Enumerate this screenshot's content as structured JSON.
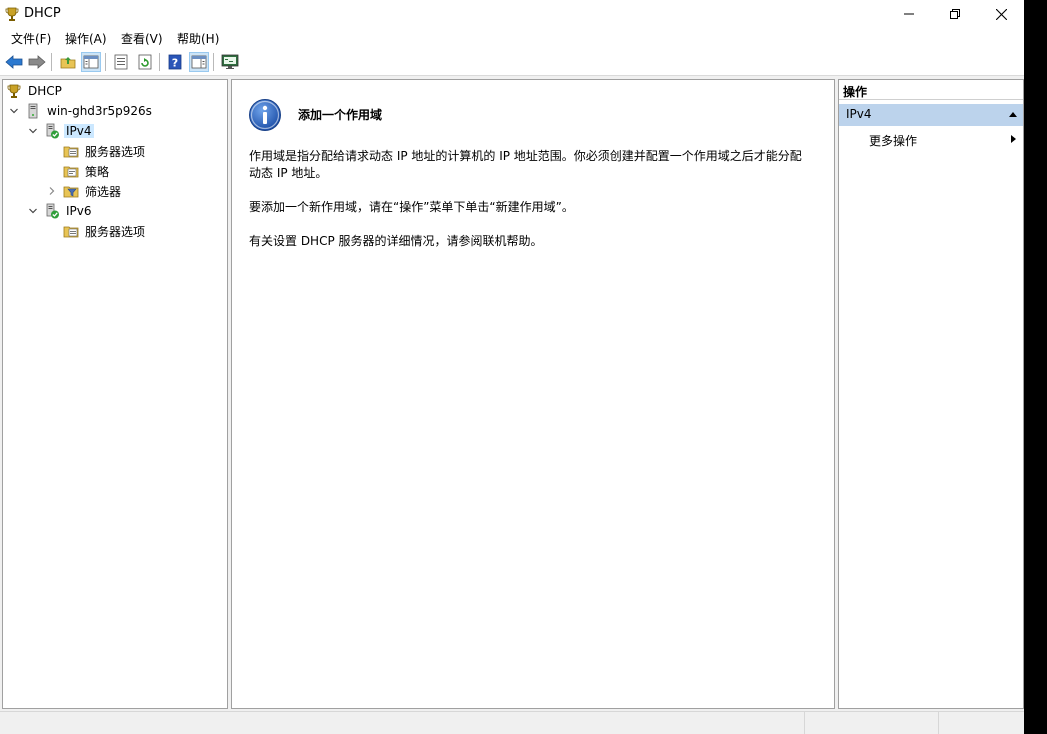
{
  "window": {
    "title": "DHCP",
    "controls": {
      "minimize": "minimize-icon",
      "maximize": "restore-icon",
      "close": "close-icon"
    }
  },
  "menu": {
    "items": [
      {
        "label": "文件(F)"
      },
      {
        "label": "操作(A)"
      },
      {
        "label": "查看(V)"
      },
      {
        "label": "帮助(H)"
      }
    ]
  },
  "toolbar": {
    "buttons": [
      {
        "icon": "back-arrow-icon"
      },
      {
        "icon": "forward-arrow-icon"
      },
      {
        "icon": "up-folder-icon"
      },
      {
        "icon": "show-hide-tree-icon",
        "pressed": true
      },
      {
        "icon": "properties-icon"
      },
      {
        "icon": "refresh-icon"
      },
      {
        "icon": "help-icon"
      },
      {
        "icon": "show-hide-action-pane-icon",
        "pressed": true
      },
      {
        "icon": "monitor-icon"
      }
    ]
  },
  "tree": {
    "root": {
      "label": "DHCP",
      "icon": "dhcp-trophy-icon"
    },
    "server": {
      "label": "win-ghd3r5p926s",
      "icon": "server-icon"
    },
    "ipv4": {
      "label": "IPv4",
      "children": [
        {
          "label": "服务器选项"
        },
        {
          "label": "策略"
        },
        {
          "label": "筛选器"
        }
      ]
    },
    "ipv6": {
      "label": "IPv6",
      "children": [
        {
          "label": "服务器选项"
        }
      ]
    }
  },
  "result": {
    "heading": "添加一个作用域",
    "paragraphs": [
      "作用域是指分配给请求动态 IP 地址的计算机的 IP 地址范围。你必须创建并配置一个作用域之后才能分配动态 IP 地址。",
      "要添加一个新作用域，请在“操作”菜单下单击“新建作用域”。",
      "有关设置 DHCP 服务器的详细情况，请参阅联机帮助。"
    ]
  },
  "actions": {
    "header": "操作",
    "group": "IPv4",
    "items": [
      {
        "label": "更多操作"
      }
    ]
  },
  "colors": {
    "selection": "#cce8ff",
    "actions_group_bg": "#bcd3ec",
    "pane_border": "#a0a0a0"
  }
}
